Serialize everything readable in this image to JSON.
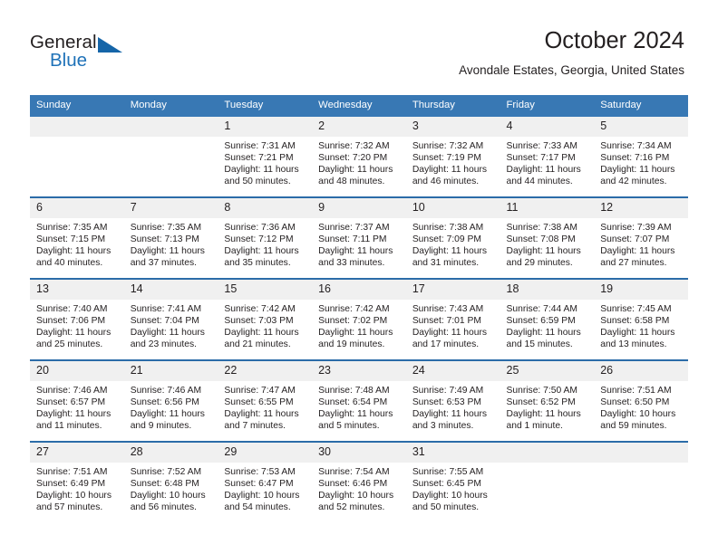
{
  "brand": {
    "word_one": "General",
    "word_two": "Blue",
    "accent_color": "#1f72b8"
  },
  "header": {
    "title": "October 2024",
    "subtitle": "Avondale Estates, Georgia, United States"
  },
  "theme": {
    "header_bg": "#3878b4",
    "week_divider": "#2b6ca8",
    "daynum_bg": "#f0f0f0"
  },
  "calendar": {
    "weekday_headers": [
      "Sunday",
      "Monday",
      "Tuesday",
      "Wednesday",
      "Thursday",
      "Friday",
      "Saturday"
    ],
    "weeks": [
      [
        {
          "day": "",
          "sunrise": "",
          "sunset": "",
          "daylight": ""
        },
        {
          "day": "",
          "sunrise": "",
          "sunset": "",
          "daylight": ""
        },
        {
          "day": "1",
          "sunrise": "Sunrise: 7:31 AM",
          "sunset": "Sunset: 7:21 PM",
          "daylight": "Daylight: 11 hours and 50 minutes."
        },
        {
          "day": "2",
          "sunrise": "Sunrise: 7:32 AM",
          "sunset": "Sunset: 7:20 PM",
          "daylight": "Daylight: 11 hours and 48 minutes."
        },
        {
          "day": "3",
          "sunrise": "Sunrise: 7:32 AM",
          "sunset": "Sunset: 7:19 PM",
          "daylight": "Daylight: 11 hours and 46 minutes."
        },
        {
          "day": "4",
          "sunrise": "Sunrise: 7:33 AM",
          "sunset": "Sunset: 7:17 PM",
          "daylight": "Daylight: 11 hours and 44 minutes."
        },
        {
          "day": "5",
          "sunrise": "Sunrise: 7:34 AM",
          "sunset": "Sunset: 7:16 PM",
          "daylight": "Daylight: 11 hours and 42 minutes."
        }
      ],
      [
        {
          "day": "6",
          "sunrise": "Sunrise: 7:35 AM",
          "sunset": "Sunset: 7:15 PM",
          "daylight": "Daylight: 11 hours and 40 minutes."
        },
        {
          "day": "7",
          "sunrise": "Sunrise: 7:35 AM",
          "sunset": "Sunset: 7:13 PM",
          "daylight": "Daylight: 11 hours and 37 minutes."
        },
        {
          "day": "8",
          "sunrise": "Sunrise: 7:36 AM",
          "sunset": "Sunset: 7:12 PM",
          "daylight": "Daylight: 11 hours and 35 minutes."
        },
        {
          "day": "9",
          "sunrise": "Sunrise: 7:37 AM",
          "sunset": "Sunset: 7:11 PM",
          "daylight": "Daylight: 11 hours and 33 minutes."
        },
        {
          "day": "10",
          "sunrise": "Sunrise: 7:38 AM",
          "sunset": "Sunset: 7:09 PM",
          "daylight": "Daylight: 11 hours and 31 minutes."
        },
        {
          "day": "11",
          "sunrise": "Sunrise: 7:38 AM",
          "sunset": "Sunset: 7:08 PM",
          "daylight": "Daylight: 11 hours and 29 minutes."
        },
        {
          "day": "12",
          "sunrise": "Sunrise: 7:39 AM",
          "sunset": "Sunset: 7:07 PM",
          "daylight": "Daylight: 11 hours and 27 minutes."
        }
      ],
      [
        {
          "day": "13",
          "sunrise": "Sunrise: 7:40 AM",
          "sunset": "Sunset: 7:06 PM",
          "daylight": "Daylight: 11 hours and 25 minutes."
        },
        {
          "day": "14",
          "sunrise": "Sunrise: 7:41 AM",
          "sunset": "Sunset: 7:04 PM",
          "daylight": "Daylight: 11 hours and 23 minutes."
        },
        {
          "day": "15",
          "sunrise": "Sunrise: 7:42 AM",
          "sunset": "Sunset: 7:03 PM",
          "daylight": "Daylight: 11 hours and 21 minutes."
        },
        {
          "day": "16",
          "sunrise": "Sunrise: 7:42 AM",
          "sunset": "Sunset: 7:02 PM",
          "daylight": "Daylight: 11 hours and 19 minutes."
        },
        {
          "day": "17",
          "sunrise": "Sunrise: 7:43 AM",
          "sunset": "Sunset: 7:01 PM",
          "daylight": "Daylight: 11 hours and 17 minutes."
        },
        {
          "day": "18",
          "sunrise": "Sunrise: 7:44 AM",
          "sunset": "Sunset: 6:59 PM",
          "daylight": "Daylight: 11 hours and 15 minutes."
        },
        {
          "day": "19",
          "sunrise": "Sunrise: 7:45 AM",
          "sunset": "Sunset: 6:58 PM",
          "daylight": "Daylight: 11 hours and 13 minutes."
        }
      ],
      [
        {
          "day": "20",
          "sunrise": "Sunrise: 7:46 AM",
          "sunset": "Sunset: 6:57 PM",
          "daylight": "Daylight: 11 hours and 11 minutes."
        },
        {
          "day": "21",
          "sunrise": "Sunrise: 7:46 AM",
          "sunset": "Sunset: 6:56 PM",
          "daylight": "Daylight: 11 hours and 9 minutes."
        },
        {
          "day": "22",
          "sunrise": "Sunrise: 7:47 AM",
          "sunset": "Sunset: 6:55 PM",
          "daylight": "Daylight: 11 hours and 7 minutes."
        },
        {
          "day": "23",
          "sunrise": "Sunrise: 7:48 AM",
          "sunset": "Sunset: 6:54 PM",
          "daylight": "Daylight: 11 hours and 5 minutes."
        },
        {
          "day": "24",
          "sunrise": "Sunrise: 7:49 AM",
          "sunset": "Sunset: 6:53 PM",
          "daylight": "Daylight: 11 hours and 3 minutes."
        },
        {
          "day": "25",
          "sunrise": "Sunrise: 7:50 AM",
          "sunset": "Sunset: 6:52 PM",
          "daylight": "Daylight: 11 hours and 1 minute."
        },
        {
          "day": "26",
          "sunrise": "Sunrise: 7:51 AM",
          "sunset": "Sunset: 6:50 PM",
          "daylight": "Daylight: 10 hours and 59 minutes."
        }
      ],
      [
        {
          "day": "27",
          "sunrise": "Sunrise: 7:51 AM",
          "sunset": "Sunset: 6:49 PM",
          "daylight": "Daylight: 10 hours and 57 minutes."
        },
        {
          "day": "28",
          "sunrise": "Sunrise: 7:52 AM",
          "sunset": "Sunset: 6:48 PM",
          "daylight": "Daylight: 10 hours and 56 minutes."
        },
        {
          "day": "29",
          "sunrise": "Sunrise: 7:53 AM",
          "sunset": "Sunset: 6:47 PM",
          "daylight": "Daylight: 10 hours and 54 minutes."
        },
        {
          "day": "30",
          "sunrise": "Sunrise: 7:54 AM",
          "sunset": "Sunset: 6:46 PM",
          "daylight": "Daylight: 10 hours and 52 minutes."
        },
        {
          "day": "31",
          "sunrise": "Sunrise: 7:55 AM",
          "sunset": "Sunset: 6:45 PM",
          "daylight": "Daylight: 10 hours and 50 minutes."
        },
        {
          "day": "",
          "sunrise": "",
          "sunset": "",
          "daylight": ""
        },
        {
          "day": "",
          "sunrise": "",
          "sunset": "",
          "daylight": ""
        }
      ]
    ]
  }
}
